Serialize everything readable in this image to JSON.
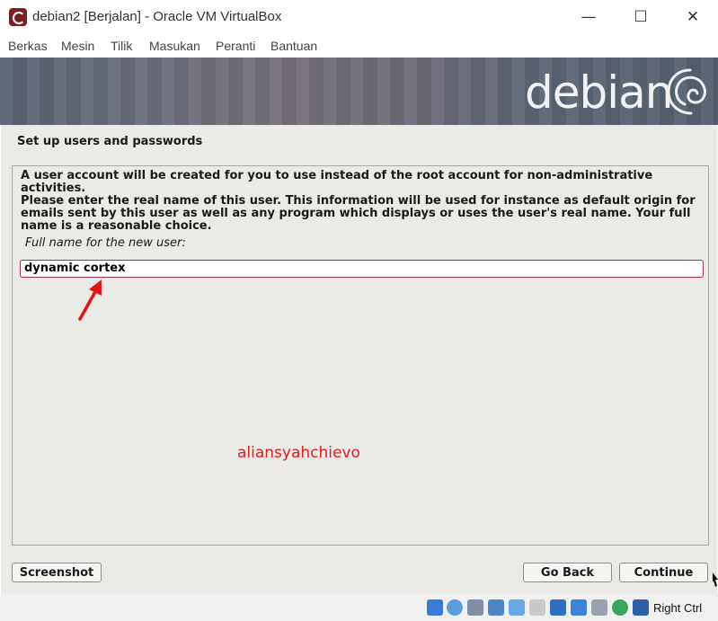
{
  "window": {
    "title": "debian2 [Berjalan] - Oracle VM VirtualBox",
    "minimize_glyph": "—",
    "maximize_glyph": "☐",
    "close_glyph": "✕"
  },
  "menu": [
    "Berkas",
    "Mesin",
    "Tilik",
    "Masukan",
    "Peranti",
    "Bantuan"
  ],
  "banner": {
    "logo_text": "debian"
  },
  "installer": {
    "page_title": "Set up users and passwords",
    "intro_text": "A user account will be created for you to use instead of the root account for non-administrative activities.",
    "instruction_lines": [
      "Please enter the real name of this user. This information will be used for instance as default origin for",
      "emails sent by this user as well as any program which displays or uses the user's real name. Your full",
      "name is a reasonable choice."
    ],
    "field_label": "Full name for the new user:",
    "full_name_value": "dynamic cortex",
    "watermark": "aliansyahchievo",
    "screenshot_label": "Screenshot",
    "back_label": "Go Back",
    "continue_label": "Continue"
  },
  "statusbar": {
    "host_key": "Right Ctrl",
    "icons": [
      "hard-disk-icon",
      "optical-drive-icon",
      "audio-icon",
      "network-icon",
      "usb-icon",
      "shared-folders-icon",
      "display-icon",
      "screen-capture-icon",
      "cpu-icon",
      "guest-additions-icon",
      "mouse-integration-icon"
    ]
  },
  "colors": {
    "accent_red": "#e21d1d",
    "field_border": "#a5324f",
    "installer_bg": "#ebeae6"
  }
}
